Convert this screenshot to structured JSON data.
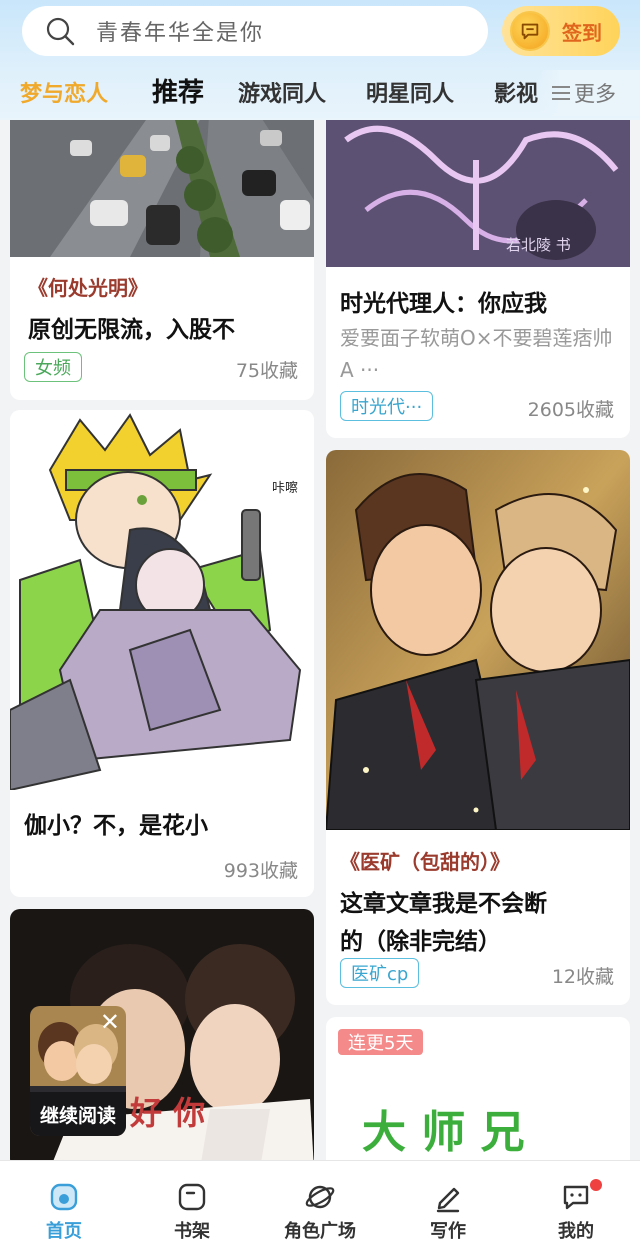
{
  "search": {
    "placeholder": "青春年华全是你"
  },
  "checkin": {
    "label": "签到"
  },
  "tabs": [
    {
      "label": "梦与恋人",
      "active": true
    },
    {
      "label": "推荐"
    },
    {
      "label": "游戏同人"
    },
    {
      "label": "明星同人"
    },
    {
      "label": "影视"
    }
  ],
  "more": {
    "label": "更多"
  },
  "cards": {
    "c1": {
      "quote": "《何处光明》",
      "title": "原创无限流，入股不",
      "tag": "女频",
      "fav": "75收藏"
    },
    "c2": {
      "cover_text": "若北陵 书",
      "title": "时光代理人：你应我",
      "desc": "爱要面子软萌O×不要碧莲痞帅A ···",
      "tag": "时光代···",
      "fav": "2605收藏"
    },
    "c3": {
      "cover_text": "咔嚓",
      "title": "伽小？不，是花小",
      "fav": "993收藏"
    },
    "c4": {
      "quote": "《医矿（包甜的）》",
      "title_line1": "这章文章我是不会断",
      "title_line2": "的（除非完结）",
      "tag": "医矿cp",
      "fav": "12收藏"
    },
    "c5": {
      "cover_text": "好 你"
    },
    "c6": {
      "badge": "连更5天",
      "cover_text": "大 师 兄"
    }
  },
  "continue_reading": {
    "label": "继续阅读"
  },
  "bottom_nav": [
    {
      "label": "首页",
      "active": true
    },
    {
      "label": "书架"
    },
    {
      "label": "角色广场"
    },
    {
      "label": "写作"
    },
    {
      "label": "我的"
    }
  ],
  "colors": {
    "accent": "#3a9fd9",
    "active_tab": "#f0a92a",
    "quote": "#9a3b2e"
  }
}
